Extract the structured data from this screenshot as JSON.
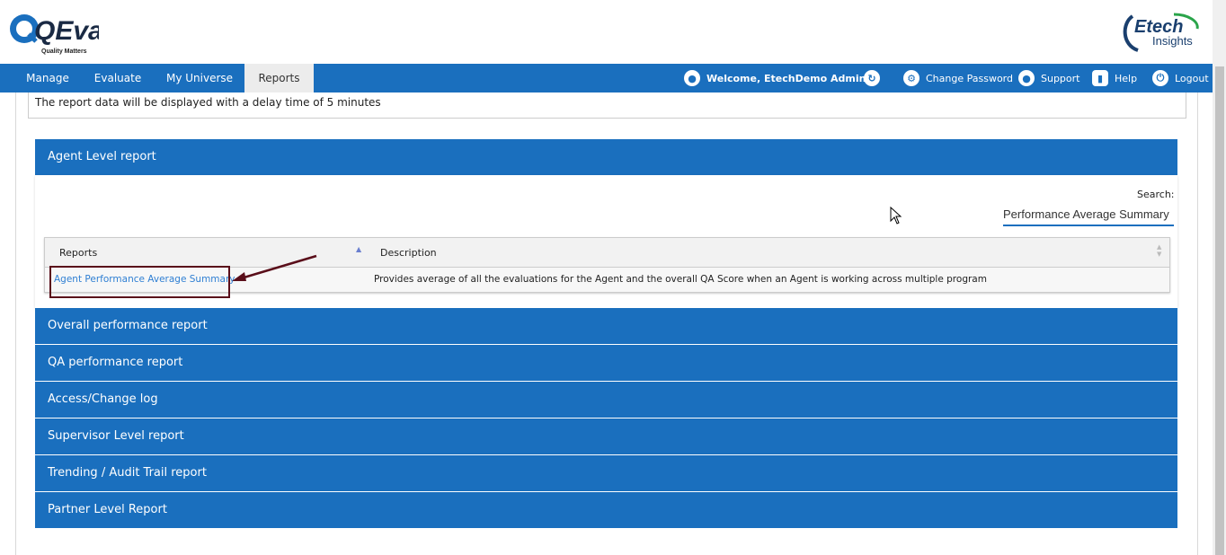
{
  "header": {
    "brand": "QEval",
    "tagline": "Quality Matters",
    "partner_brand": "Etech",
    "partner_sub": "Insights"
  },
  "nav": {
    "items": [
      {
        "label": "Manage"
      },
      {
        "label": "Evaluate"
      },
      {
        "label": "My Universe"
      },
      {
        "label": "Reports"
      }
    ],
    "welcome": "Welcome, EtechDemo Admin",
    "change_password": "Change Password",
    "support": "Support",
    "help": "Help",
    "logout": "Logout"
  },
  "notice": "The report data will be displayed with a delay time of 5 minutes",
  "agent_section": {
    "title": "Agent Level report",
    "search_label": "Search:",
    "search_value": "Performance Average Summary",
    "columns": [
      "Reports",
      "Description"
    ],
    "rows": [
      {
        "report": "Agent Performance Average Summary",
        "description": "Provides average of all the evaluations for the Agent and the overall QA Score when an Agent is working across multiple program"
      }
    ]
  },
  "sections": [
    "Overall performance report",
    "QA performance report",
    "Access/Change log",
    "Supervisor Level report",
    "Trending / Audit Trail report",
    "Partner Level Report"
  ],
  "colors": {
    "primary": "#1a6fbe",
    "link": "#2f7fd3",
    "highlight": "#5a0e1a"
  }
}
